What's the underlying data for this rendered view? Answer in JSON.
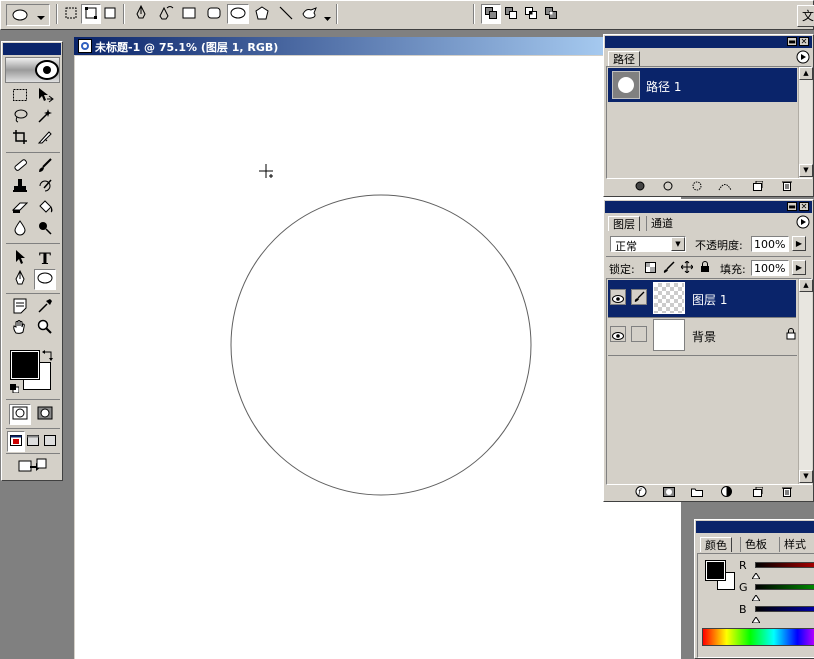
{
  "options_bar": {
    "icons": [
      "ellipse-tool-preset-icon",
      "dropdown-arrow-icon",
      "shape-layers-icon",
      "paths-icon",
      "fill-pixels-icon",
      "pen-icon",
      "freeform-pen-icon",
      "rectangle-icon",
      "rounded-rectangle-icon",
      "ellipse-icon",
      "polygon-icon",
      "line-icon",
      "custom-shape-icon",
      "dropdown-arrow-icon",
      "add-to-area-icon",
      "subtract-area-icon",
      "intersect-area-icon",
      "exclude-area-icon"
    ],
    "right_label": "文"
  },
  "document": {
    "title": "未标题-1 @ 75.1% (图层 1, RGB)"
  },
  "paths_panel": {
    "tab": "路径",
    "items": [
      {
        "label": "路径 1",
        "selected": true
      }
    ],
    "footer_icons": [
      "fill-path-icon",
      "stroke-path-icon",
      "load-selection-icon",
      "make-work-path-icon",
      "new-path-icon",
      "trash-icon"
    ]
  },
  "layers_panel": {
    "tabs": [
      "图层",
      "通道"
    ],
    "blend_mode": "正常",
    "opacity_label": "不透明度:",
    "opacity_value": "100%",
    "lock_label": "锁定:",
    "fill_label": "填充:",
    "fill_value": "100%",
    "layers": [
      {
        "name": "图层 1",
        "selected": true,
        "transparent": true,
        "locked": false
      },
      {
        "name": "背景",
        "selected": false,
        "transparent": false,
        "locked": true
      }
    ],
    "footer_icons": [
      "layer-style-icon",
      "add-mask-icon",
      "new-set-icon",
      "adjustment-layer-icon",
      "new-layer-icon",
      "trash-icon"
    ]
  },
  "color_panel": {
    "tabs": [
      "颜色",
      "色板",
      "样式"
    ],
    "channels": [
      "R",
      "G",
      "B"
    ],
    "colors": {
      "r_track": "#c00000",
      "g_track": "#00a000",
      "b_track": "#0000c0"
    }
  },
  "colors": {
    "workspace": "#808080",
    "chrome": "#d4d0c8",
    "selection": "#0a246a",
    "title_gradient_start": "#0a246a",
    "title_gradient_end": "#a6caf0"
  }
}
